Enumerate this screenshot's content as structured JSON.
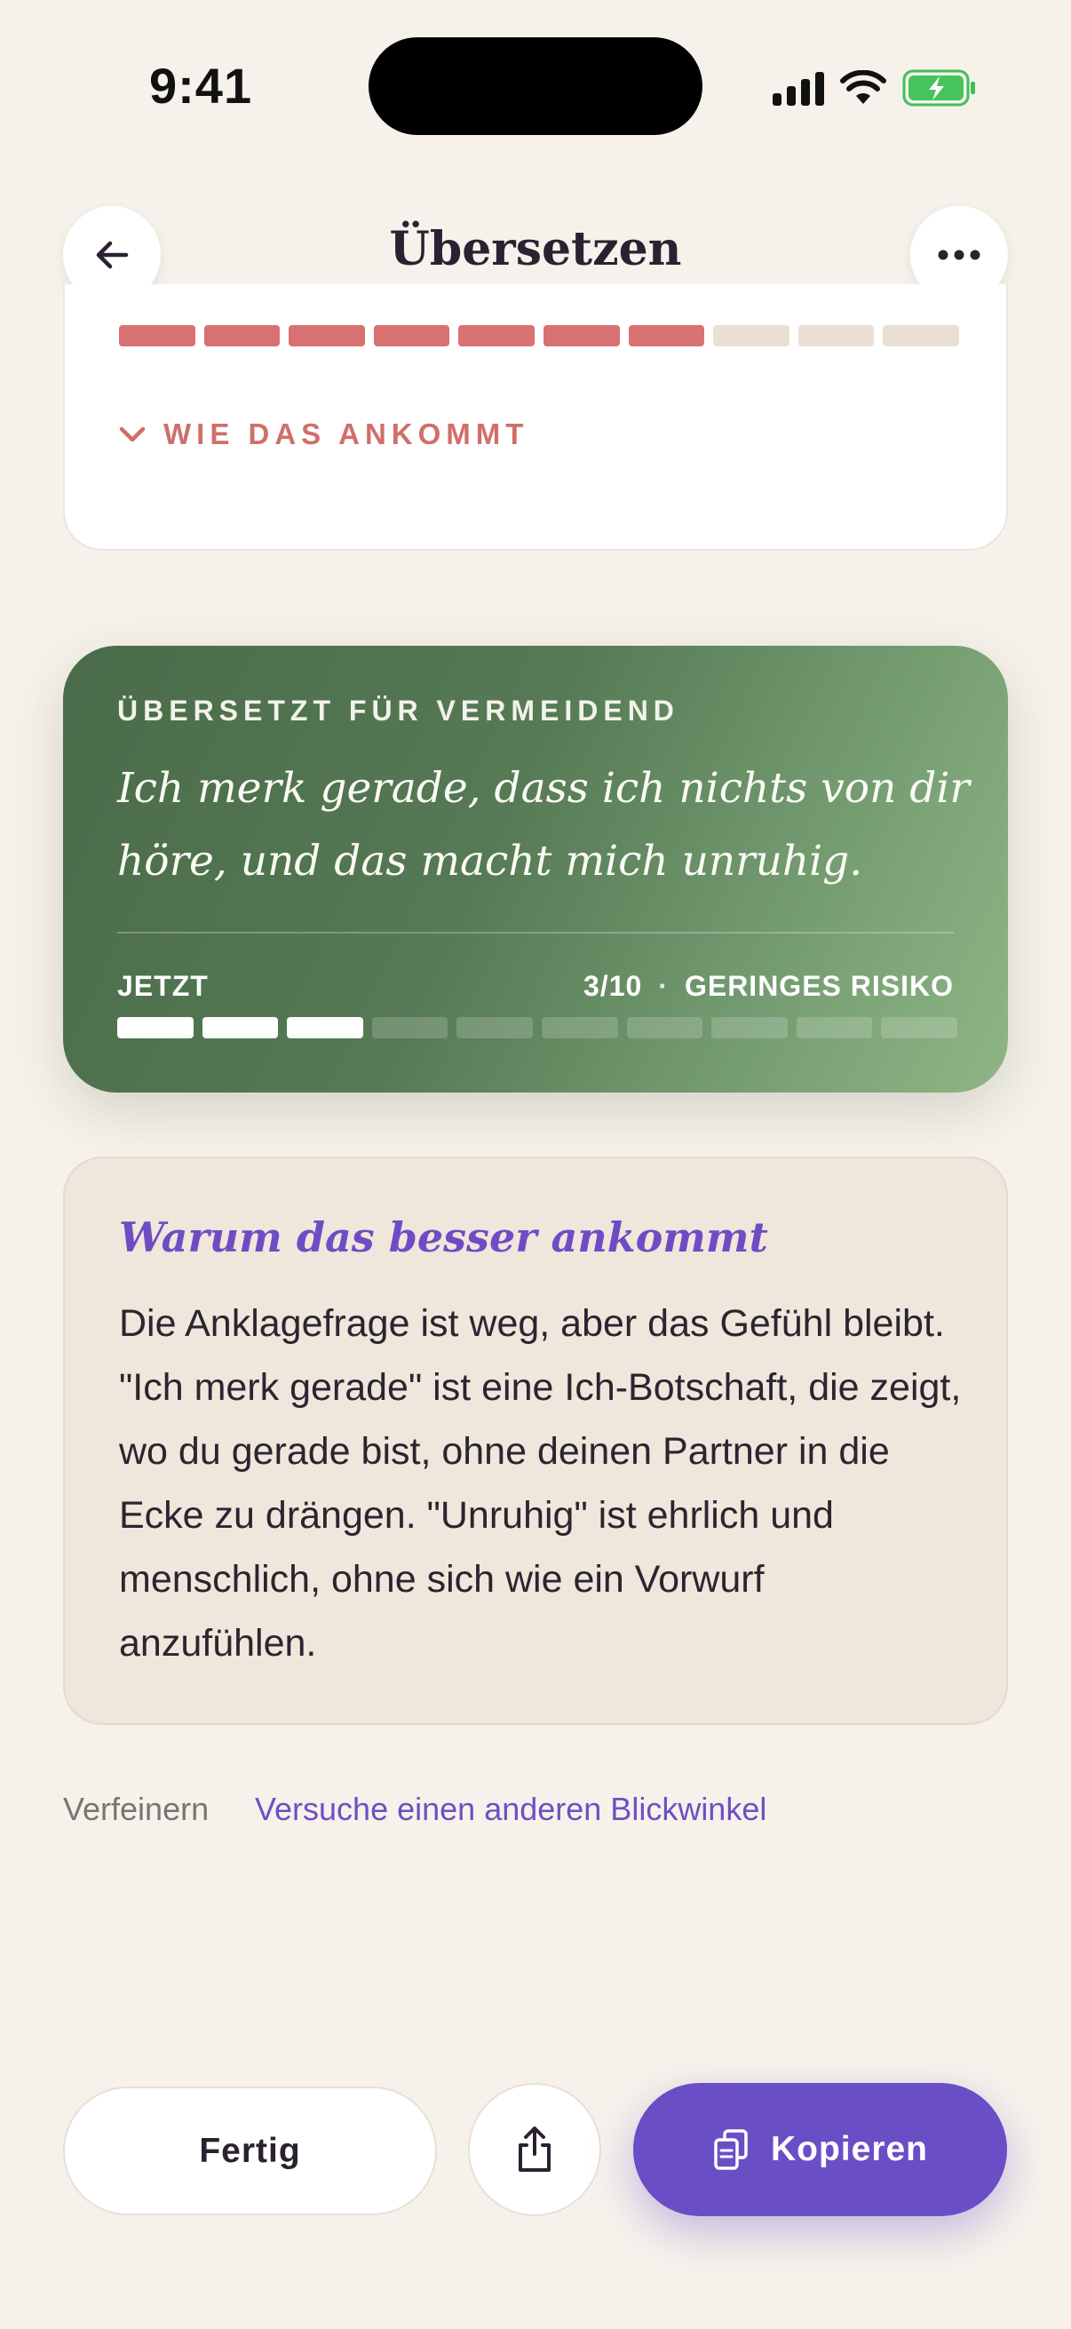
{
  "status_bar": {
    "time": "9:41"
  },
  "header": {
    "title": "Übersetzen"
  },
  "original": {
    "meter_filled": 7,
    "meter_total": 10,
    "expand_label": "WIE DAS ANKOMMT"
  },
  "translated": {
    "label": "ÜBERSETZT FÜR VERMEIDEND",
    "text": "Ich merk gerade, dass ich nichts von dir höre, und das macht mich unruhig.",
    "now_label": "JETZT",
    "score": "3/10",
    "separator": "·",
    "risk": "GERINGES RISIKO",
    "meter_filled": 3,
    "meter_total": 10
  },
  "explanation": {
    "title": "Warum das besser ankommt",
    "body": "Die Anklagefrage ist weg, aber das Gefühl bleibt. \"Ich merk gerade\" ist eine Ich-Botschaft, die zeigt, wo du gerade bist, ohne deinen Partner in die Ecke zu drängen. \"Unruhig\" ist ehrlich und menschlich, ohne sich wie ein Vorwurf anzufühlen."
  },
  "refine": {
    "label": "Verfeinern",
    "link": "Versuche einen anderen Blickwinkel"
  },
  "actions": {
    "done": "Fertig",
    "copy": "Kopieren"
  },
  "colors": {
    "background": "#f6f2eb",
    "accent": "#6a4ec6",
    "risk_red": "#d87272",
    "green": "#567a55"
  },
  "icons": [
    "back-arrow-icon",
    "more-dots-icon",
    "chevron-down-icon",
    "share-icon",
    "copy-icon",
    "signal-icon",
    "wifi-icon",
    "battery-icon"
  ]
}
